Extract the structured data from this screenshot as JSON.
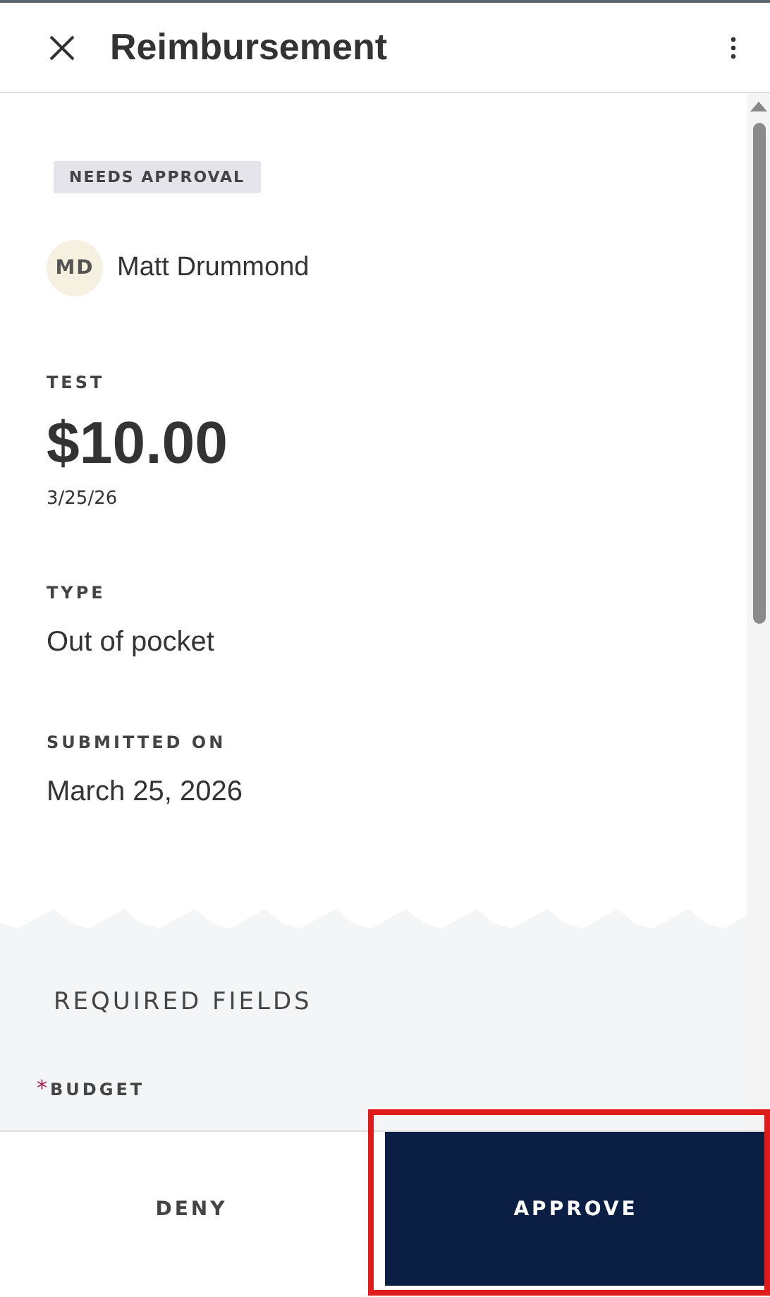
{
  "header": {
    "title": "Reimbursement"
  },
  "status_badge": "NEEDS APPROVAL",
  "submitter": {
    "initials": "MD",
    "name": "Matt Drummond"
  },
  "expense": {
    "label": "TEST",
    "amount": "$10.00",
    "date": "3/25/26"
  },
  "details": [
    {
      "label": "TYPE",
      "value": "Out of pocket"
    },
    {
      "label": "SUBMITTED ON",
      "value": "March 25, 2026"
    }
  ],
  "required_section": {
    "title": "REQUIRED FIELDS",
    "fields": [
      {
        "label": "BUDGET",
        "required": true,
        "required_marker": "*"
      }
    ]
  },
  "actions": [
    {
      "label": "DENY",
      "kind": "secondary",
      "highlighted": false
    },
    {
      "label": "APPROVE",
      "kind": "primary",
      "highlighted": true
    }
  ]
}
